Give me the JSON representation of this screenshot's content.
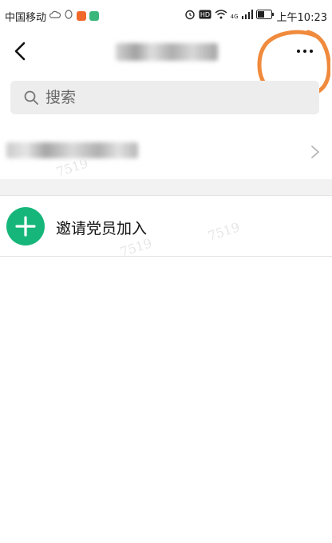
{
  "status_bar": {
    "carrier": "中国移动",
    "network": "4G",
    "time": "上午10:23"
  },
  "header": {
    "back_icon": "back-chevron-icon",
    "more_icon": "more-dots-icon"
  },
  "search": {
    "placeholder": "搜索"
  },
  "invite": {
    "label": "邀请党员加入",
    "icon": "plus-icon"
  },
  "watermarks": [
    "7519",
    "7519",
    "7519"
  ],
  "colors": {
    "accent_green": "#16b67a",
    "annotation_orange": "#f08a3c",
    "search_bg": "#ededed",
    "gap_band": "#f2f2f2"
  }
}
